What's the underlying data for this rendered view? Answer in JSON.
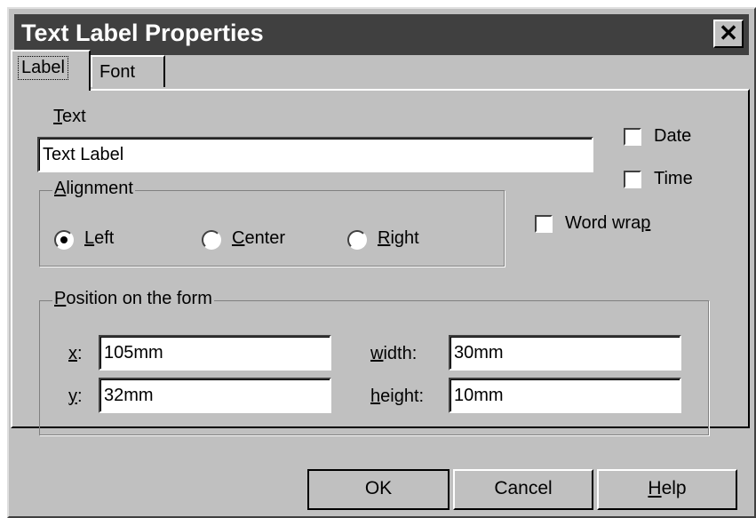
{
  "dialog": {
    "title": "Text Label Properties",
    "close_glyph": "✕"
  },
  "tabs": [
    {
      "label": "Label",
      "active": true
    },
    {
      "label": "Font",
      "active": false
    }
  ],
  "text_field": {
    "label_access": "T",
    "label_rest": "ext",
    "value": "Text Label"
  },
  "checkboxes": {
    "date": {
      "label": "Date",
      "checked": false
    },
    "time": {
      "label": "Time",
      "checked": false
    },
    "word_wrap": {
      "label_main": "Word wra",
      "label_access": "p",
      "checked": false
    }
  },
  "alignment": {
    "title_access": "A",
    "title_rest": "lignment",
    "options": [
      {
        "access": "L",
        "rest": "eft",
        "selected": true
      },
      {
        "access": "C",
        "rest": "enter",
        "selected": false
      },
      {
        "access": "R",
        "rest": "ight",
        "selected": false
      }
    ]
  },
  "position": {
    "title_access": "P",
    "title_rest": "osition on the form",
    "x": {
      "access": "x",
      "rest": ":",
      "value": "105mm"
    },
    "y": {
      "access": "y",
      "rest": ":",
      "value": "32mm"
    },
    "width": {
      "access": "w",
      "rest": "idth:",
      "value": "30mm"
    },
    "height": {
      "access": "h",
      "rest": "eight:",
      "value": "10mm"
    }
  },
  "buttons": {
    "ok": "OK",
    "cancel": "Cancel",
    "help_access": "H",
    "help_rest": "elp"
  }
}
